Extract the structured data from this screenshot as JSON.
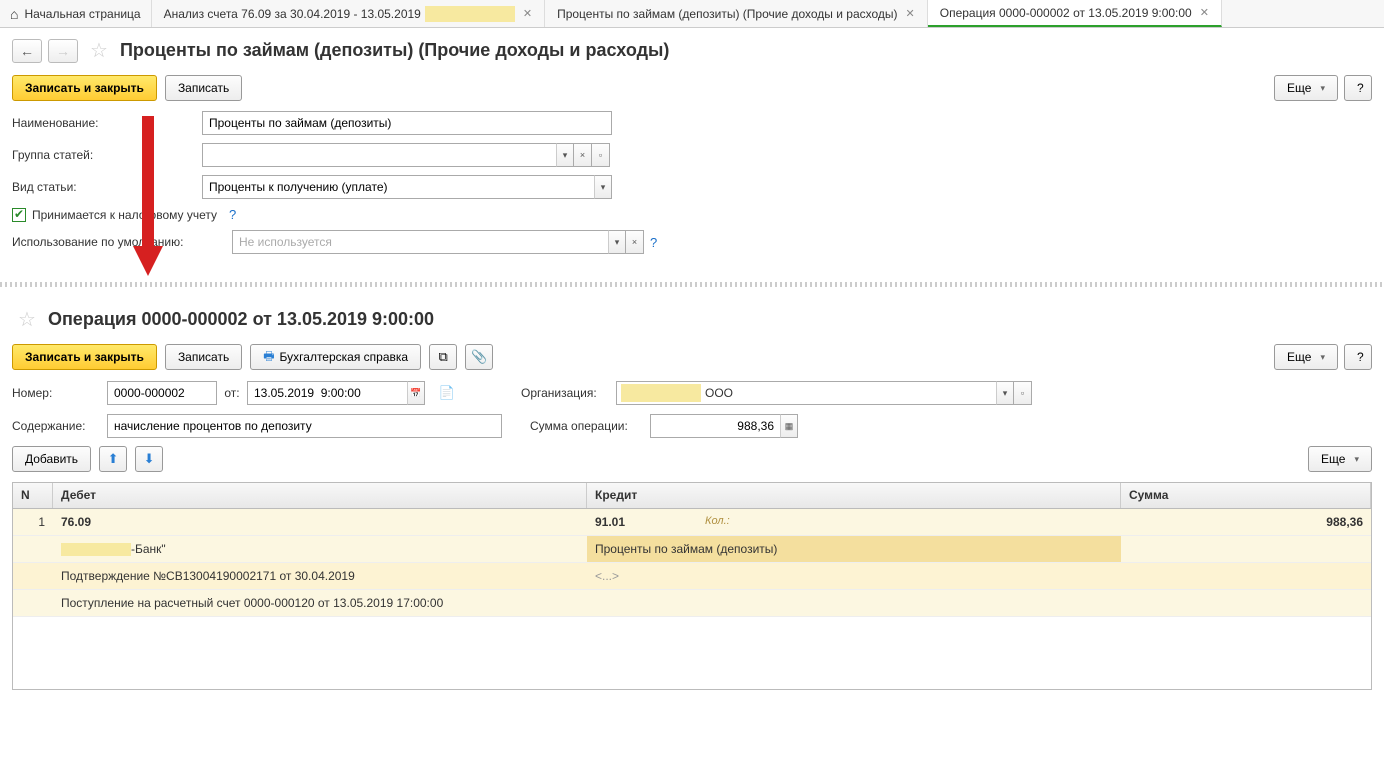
{
  "tabs": {
    "home": "Начальная страница",
    "t1": "Анализ счета 76.09 за 30.04.2019 - 13.05.2019",
    "t2": "Проценты по займам (депозиты) (Прочие доходы и расходы)",
    "t3": "Операция 0000-000002 от 13.05.2019 9:00:00"
  },
  "top": {
    "title": "Проценты по займам (депозиты) (Прочие доходы и расходы)",
    "save_close": "Записать и закрыть",
    "save": "Записать",
    "more": "Еще",
    "help": "?",
    "labels": {
      "name": "Наименование:",
      "group": "Группа статей:",
      "type": "Вид статьи:",
      "tax": "Принимается к налоговому учету",
      "usage": "Использование по умолчанию:"
    },
    "values": {
      "name": "Проценты по займам (депозиты)",
      "group": "",
      "type": "Проценты к получению (уплате)",
      "usage": "Не используется"
    }
  },
  "bottom": {
    "title": "Операция 0000-000002 от 13.05.2019 9:00:00",
    "save_close": "Записать и закрыть",
    "save": "Записать",
    "accounting_ref": "Бухгалтерская справка",
    "more": "Еще",
    "help": "?",
    "labels": {
      "number": "Номер:",
      "from": "от:",
      "org": "Организация:",
      "content": "Содержание:",
      "sum_op": "Сумма операции:"
    },
    "values": {
      "number": "0000-000002",
      "date": "13.05.2019  9:00:00",
      "org": "ООО",
      "content": "начисление процентов по депозиту",
      "sum_op": "988,36"
    },
    "add": "Добавить",
    "table": {
      "headers": {
        "n": "N",
        "debit": "Дебет",
        "credit": "Кредит",
        "sum": "Сумма"
      },
      "row": {
        "n": "1",
        "debit_account": "76.09",
        "credit_account": "91.01",
        "kol": "Кол.:",
        "sum": "988,36",
        "debit_sub1": "-Банк\"",
        "credit_sub1": "Проценты по займам (депозиты)",
        "debit_sub2": "Подтверждение №СВ13004190002171 от 30.04.2019",
        "credit_sub2": "<...>",
        "debit_sub3": "Поступление на расчетный счет 0000-000120 от 13.05.2019 17:00:00"
      }
    }
  }
}
